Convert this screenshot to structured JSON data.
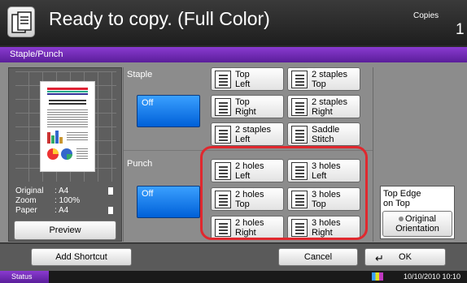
{
  "header": {
    "title": "Ready to copy. (Full Color)",
    "copies_label": "Copies",
    "copies_count": "1"
  },
  "tab": {
    "label": "Staple/Punch"
  },
  "preview": {
    "info": [
      {
        "key": "Original",
        "value": ": A4"
      },
      {
        "key": "Zoom",
        "value": ": 100%"
      },
      {
        "key": "Paper",
        "value": ": A4"
      }
    ],
    "button_label": "Preview"
  },
  "staple": {
    "label": "Staple",
    "off_label": "Off",
    "options": [
      {
        "line1": "Top",
        "line2": "Left"
      },
      {
        "line1": "2 staples",
        "line2": "Top"
      },
      {
        "line1": "Top",
        "line2": "Right"
      },
      {
        "line1": "2 staples",
        "line2": "Right"
      },
      {
        "line1": "2 staples",
        "line2": "Left"
      },
      {
        "line1": "Saddle",
        "line2": "Stitch"
      }
    ]
  },
  "punch": {
    "label": "Punch",
    "off_label": "Off",
    "options": [
      {
        "line1": "2 holes",
        "line2": "Left"
      },
      {
        "line1": "3 holes",
        "line2": "Left"
      },
      {
        "line1": "2 holes",
        "line2": "Top"
      },
      {
        "line1": "3 holes",
        "line2": "Top"
      },
      {
        "line1": "2 holes",
        "line2": "Right"
      },
      {
        "line1": "3 holes",
        "line2": "Right"
      }
    ]
  },
  "top_edge": {
    "line1": "Top Edge",
    "line2": "on Top",
    "button_line1": "Original",
    "button_line2": "Orientation"
  },
  "bottom": {
    "add_shortcut": "Add Shortcut",
    "cancel": "Cancel",
    "ok": "OK"
  },
  "status": {
    "label": "Status",
    "datetime": "10/10/2010  10:10"
  },
  "colors": {
    "accent_purple": "#7a2cc0",
    "selected_blue": "#1a7ff0",
    "highlight_red": "#e0282e"
  }
}
